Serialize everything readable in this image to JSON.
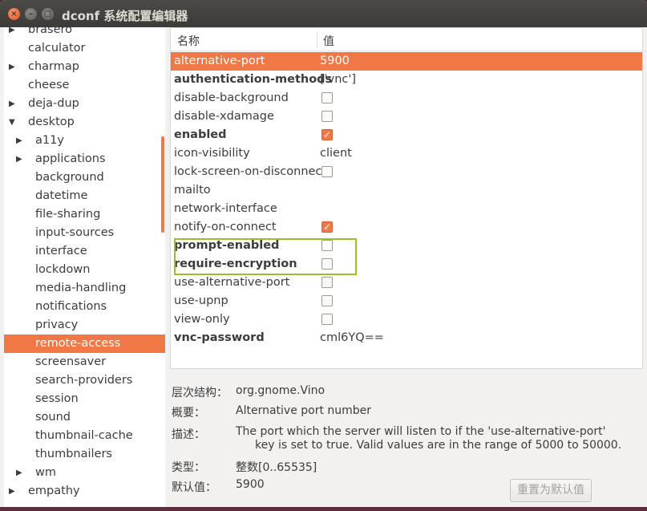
{
  "window": {
    "title": "dconf 系统配置编辑器",
    "close_glyph": "×",
    "min_glyph": "–",
    "max_glyph": "□"
  },
  "tree": {
    "items": [
      {
        "label": "brasero",
        "level": 0,
        "expander": "collapsed"
      },
      {
        "label": "calculator",
        "level": 0,
        "expander": "none"
      },
      {
        "label": "charmap",
        "level": 0,
        "expander": "collapsed"
      },
      {
        "label": "cheese",
        "level": 0,
        "expander": "none"
      },
      {
        "label": "deja-dup",
        "level": 0,
        "expander": "collapsed"
      },
      {
        "label": "desktop",
        "level": 0,
        "expander": "expanded"
      },
      {
        "label": "a11y",
        "level": 1,
        "expander": "collapsed"
      },
      {
        "label": "applications",
        "level": 1,
        "expander": "collapsed"
      },
      {
        "label": "background",
        "level": 1,
        "expander": "none"
      },
      {
        "label": "datetime",
        "level": 1,
        "expander": "none"
      },
      {
        "label": "file-sharing",
        "level": 1,
        "expander": "none"
      },
      {
        "label": "input-sources",
        "level": 1,
        "expander": "none"
      },
      {
        "label": "interface",
        "level": 1,
        "expander": "none"
      },
      {
        "label": "lockdown",
        "level": 1,
        "expander": "none"
      },
      {
        "label": "media-handling",
        "level": 1,
        "expander": "none"
      },
      {
        "label": "notifications",
        "level": 1,
        "expander": "none"
      },
      {
        "label": "privacy",
        "level": 1,
        "expander": "none"
      },
      {
        "label": "remote-access",
        "level": 1,
        "expander": "none",
        "selected": true
      },
      {
        "label": "screensaver",
        "level": 1,
        "expander": "none"
      },
      {
        "label": "search-providers",
        "level": 1,
        "expander": "none"
      },
      {
        "label": "session",
        "level": 1,
        "expander": "none"
      },
      {
        "label": "sound",
        "level": 1,
        "expander": "none"
      },
      {
        "label": "thumbnail-cache",
        "level": 1,
        "expander": "none"
      },
      {
        "label": "thumbnailers",
        "level": 1,
        "expander": "none"
      },
      {
        "label": "wm",
        "level": 1,
        "expander": "collapsed"
      },
      {
        "label": "empathy",
        "level": 0,
        "expander": "collapsed"
      }
    ]
  },
  "table": {
    "col_name": "名称",
    "col_value": "值",
    "rows": [
      {
        "name": "alternative-port",
        "bold": false,
        "type": "text",
        "value": "5900",
        "selected": true
      },
      {
        "name": "authentication-methods",
        "bold": true,
        "type": "text",
        "value": "['vnc']"
      },
      {
        "name": "disable-background",
        "bold": false,
        "type": "check",
        "checked": false
      },
      {
        "name": "disable-xdamage",
        "bold": false,
        "type": "check",
        "checked": false
      },
      {
        "name": "enabled",
        "bold": true,
        "type": "check",
        "checked": true
      },
      {
        "name": "icon-visibility",
        "bold": false,
        "type": "text",
        "value": "client"
      },
      {
        "name": "lock-screen-on-disconnect",
        "bold": false,
        "type": "check",
        "checked": false
      },
      {
        "name": "mailto",
        "bold": false,
        "type": "text",
        "value": ""
      },
      {
        "name": "network-interface",
        "bold": false,
        "type": "text",
        "value": ""
      },
      {
        "name": "notify-on-connect",
        "bold": false,
        "type": "check",
        "checked": true
      },
      {
        "name": "prompt-enabled",
        "bold": true,
        "type": "check",
        "checked": false
      },
      {
        "name": "require-encryption",
        "bold": true,
        "type": "check",
        "checked": false
      },
      {
        "name": "use-alternative-port",
        "bold": false,
        "type": "check",
        "checked": false
      },
      {
        "name": "use-upnp",
        "bold": false,
        "type": "check",
        "checked": false
      },
      {
        "name": "view-only",
        "bold": false,
        "type": "check",
        "checked": false
      },
      {
        "name": "vnc-password",
        "bold": true,
        "type": "text",
        "value": "cml6YQ=="
      }
    ],
    "check_glyph": "✓",
    "highlight_color": "#99c12a"
  },
  "info": {
    "schema_label": "层次结构：",
    "schema_value": "org.gnome.Vino",
    "summary_label": "概要：",
    "summary_value": "Alternative port number",
    "description_label": "描述：",
    "description_line1": "The port which the server will listen to if the 'use-alternative-port'",
    "description_line2": "key is set to true. Valid values are in the range of 5000 to 50000.",
    "type_label": "类型：",
    "type_value": "整数[0..65535]",
    "default_label": "默认值：",
    "default_value": "5900",
    "reset_button": "重置为默认值"
  },
  "colors": {
    "accent": "#f07746",
    "titlebar": "#3c3b37"
  }
}
